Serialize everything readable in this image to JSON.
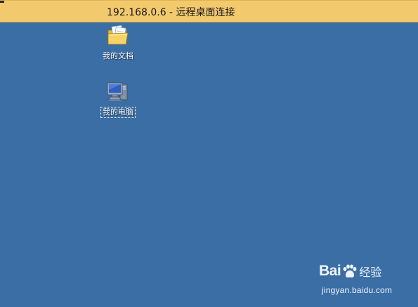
{
  "window": {
    "title": "192.168.0.6 - 远程桌面连接",
    "titlebar_color": "#f3c96d"
  },
  "desktop": {
    "background_color": "#3a6ea5",
    "icons": [
      {
        "label": "我的文档",
        "icon": "folder-documents-icon",
        "selected": false
      },
      {
        "label": "我的电脑",
        "icon": "computer-icon",
        "selected": true
      }
    ]
  },
  "watermark": {
    "brand_left": "Bai",
    "brand_right": "经验",
    "domain": "jingyan.baidu.com"
  }
}
